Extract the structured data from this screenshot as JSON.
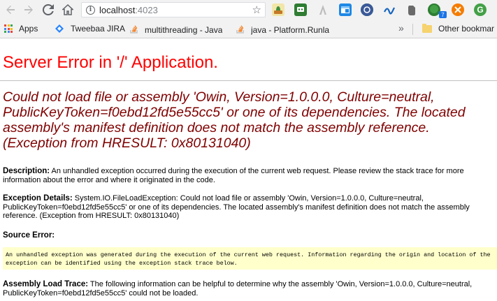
{
  "browser": {
    "url_host": "localhost",
    "url_port": ":4023",
    "nav_back_icon": "arrow-left-icon",
    "nav_forward_icon": "arrow-right-icon",
    "reload_icon": "reload-icon",
    "home_icon": "home-icon",
    "info_icon": "info-icon",
    "bookmark_star_icon": "star-icon",
    "extension_badge": "7",
    "extension_g_label": "G"
  },
  "bookmarks": {
    "apps_label": "Apps",
    "items": [
      {
        "label": "Tweebaa JIRA"
      },
      {
        "label": "multithreading - Java"
      },
      {
        "label": "java - Platform.Runla"
      }
    ],
    "overflow_label": "»",
    "other_label": "Other bookmar"
  },
  "page": {
    "title": "Server Error in '/' Application.",
    "error_message": "Could not load file or assembly 'Owin, Version=1.0.0.0, Culture=neutral, PublicKeyToken=f0ebd12fd5e55cc5' or one of its dependencies. The located assembly's manifest definition does not match the assembly reference. (Exception from HRESULT: 0x80131040)",
    "description_label": "Description:",
    "description_text": " An unhandled exception occurred during the execution of the current web request. Please review the stack trace for more information about the error and where it originated in the code.",
    "exception_label": "Exception Details:",
    "exception_text": " System.IO.FileLoadException: Could not load file or assembly 'Owin, Version=1.0.0.0, Culture=neutral, PublicKeyToken=f0ebd12fd5e55cc5' or one of its dependencies. The located assembly's manifest definition does not match the assembly reference. (Exception from HRESULT: 0x80131040)",
    "source_error_label": "Source Error:",
    "source_error_text": "An unhandled exception was generated during the execution of the current web request. Information regarding the origin and location of the exception can be identified using the exception stack trace below.",
    "assembly_trace_label": "Assembly Load Trace:",
    "assembly_trace_text": " The following information can be helpful to determine why the assembly 'Owin, Version=1.0.0.0, Culture=neutral, PublicKeyToken=f0ebd12fd5e55cc5' could not be loaded."
  },
  "colors": {
    "title_red": "#ff0000",
    "message_maroon": "#800000",
    "source_box_bg": "#ffffcc"
  }
}
